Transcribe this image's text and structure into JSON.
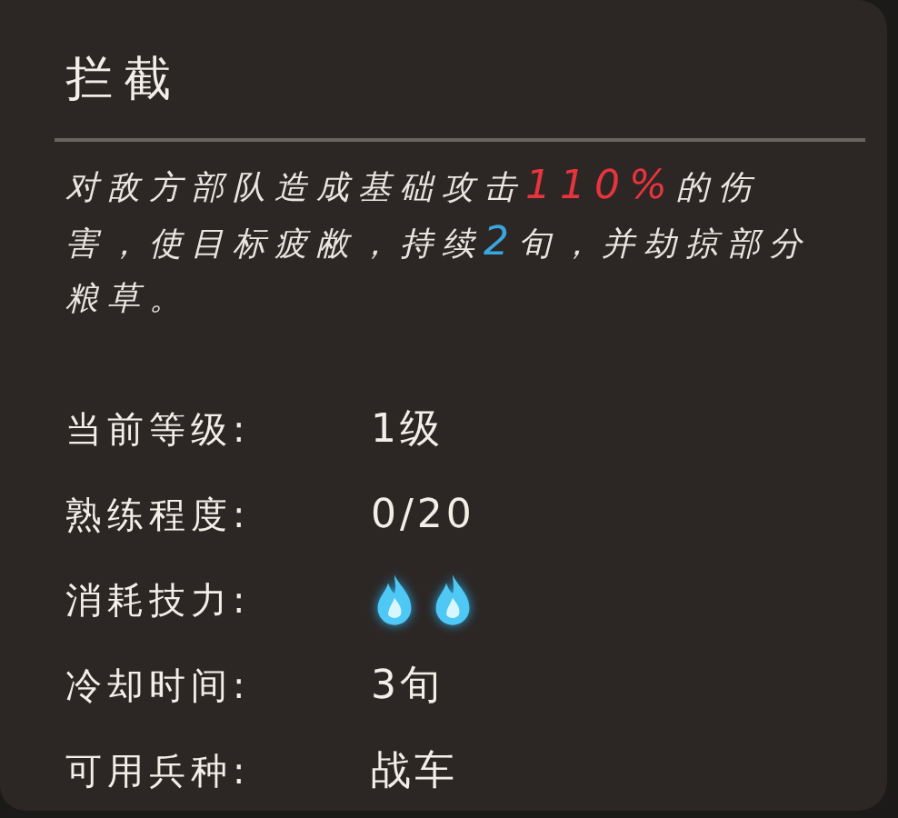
{
  "tooltip": {
    "title": "拦截",
    "description": [
      {
        "kind": "plain",
        "text": "对敌方部队造成基础攻击"
      },
      {
        "kind": "damage",
        "text": "110%"
      },
      {
        "kind": "plain",
        "text": "的伤害，使目标疲敝，持续"
      },
      {
        "kind": "duration",
        "text": "2"
      },
      {
        "kind": "plain",
        "text": "旬，并劫掠部分粮草。"
      }
    ],
    "rows": [
      {
        "label": "当前等级:",
        "kind": "text",
        "value": "1级"
      },
      {
        "label": "熟练程度:",
        "kind": "text",
        "value": "0/20"
      },
      {
        "label": "消耗技力:",
        "kind": "icons",
        "icons": [
          {
            "kind": "flame"
          },
          {
            "kind": "flame"
          }
        ]
      },
      {
        "label": "冷却时间:",
        "kind": "text",
        "value": "3旬"
      },
      {
        "label": "可用兵种:",
        "kind": "text",
        "value": "战车"
      }
    ]
  }
}
